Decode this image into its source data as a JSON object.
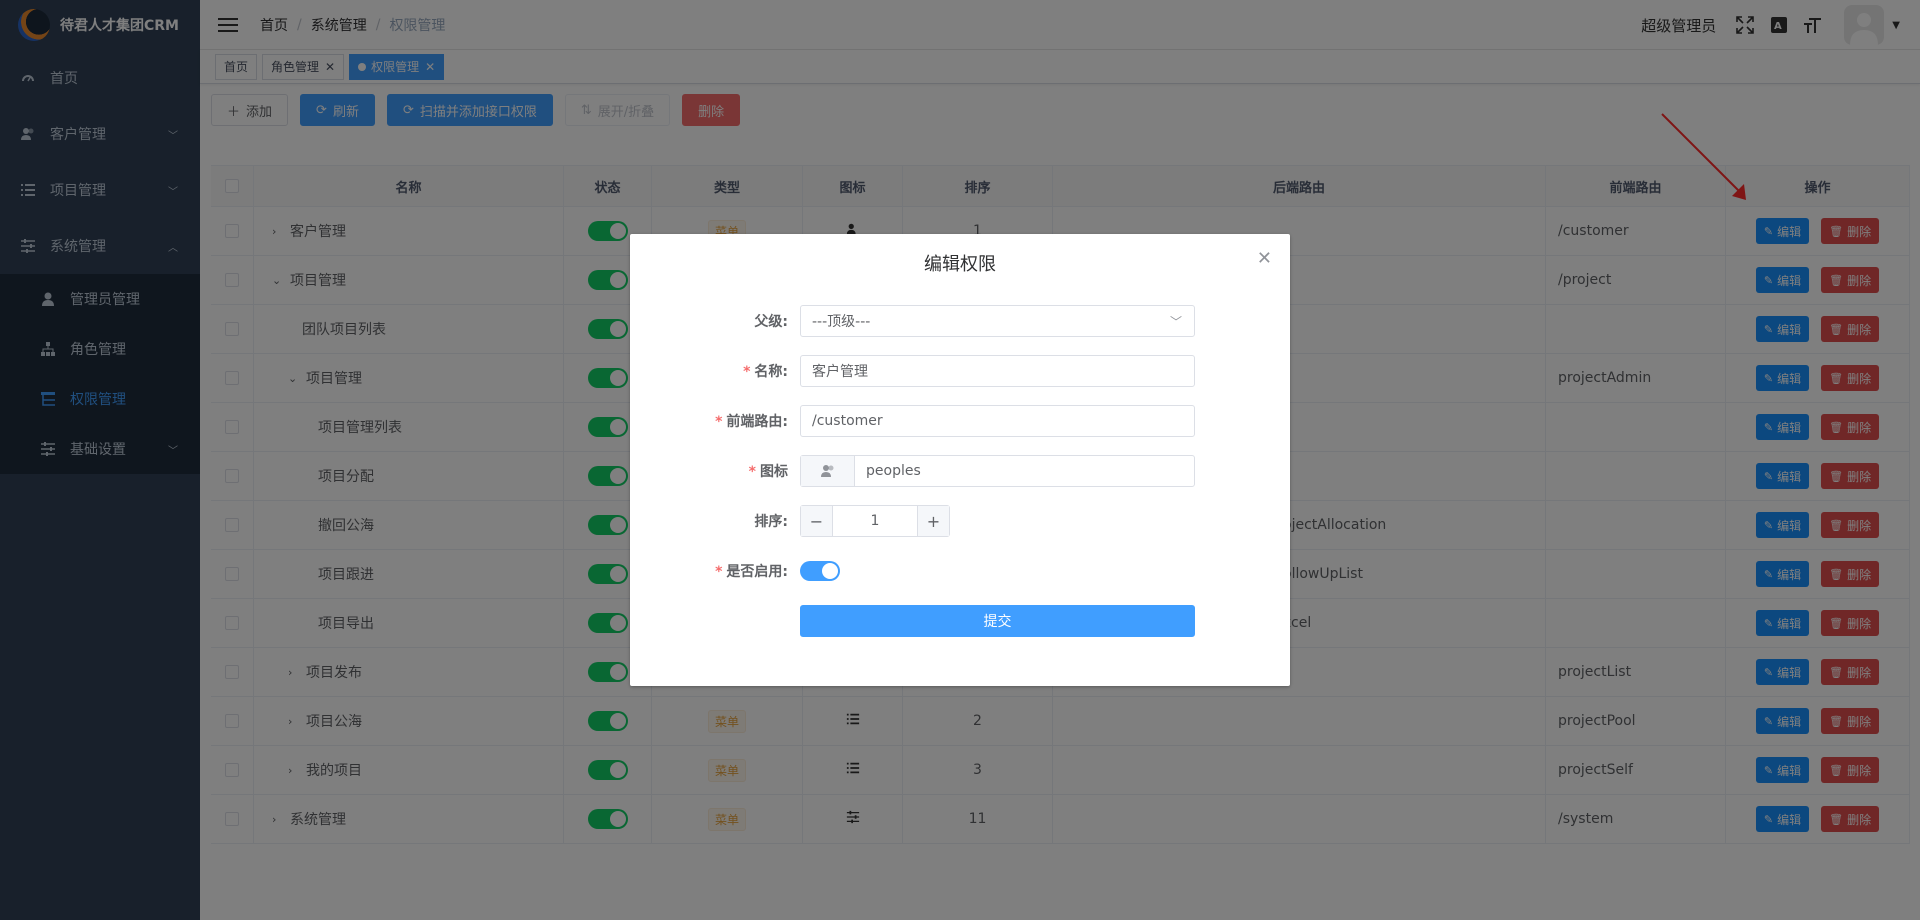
{
  "app": {
    "logo_text": "待君人才集团CRM"
  },
  "sidebar": {
    "items": [
      {
        "label": "首页",
        "icon": "dashboard-icon"
      },
      {
        "label": "客户管理",
        "icon": "peoples-icon"
      },
      {
        "label": "项目管理",
        "icon": "list-icon"
      },
      {
        "label": "系统管理",
        "icon": "system-icon"
      }
    ],
    "sub_items": [
      {
        "label": "管理员管理",
        "icon": "user-icon"
      },
      {
        "label": "角色管理",
        "icon": "tree-icon"
      },
      {
        "label": "权限管理",
        "icon": "tree-table-icon"
      },
      {
        "label": "基础设置",
        "icon": "settings-icon"
      }
    ]
  },
  "header": {
    "breadcrumb": [
      "首页",
      "系统管理",
      "权限管理"
    ],
    "username": "超级管理员",
    "font_icon": "A"
  },
  "tags": [
    {
      "label": "首页"
    },
    {
      "label": "角色管理"
    },
    {
      "label": "权限管理"
    }
  ],
  "toolbar": {
    "add": "添加",
    "refresh": "刷新",
    "scan": "扫描并添加接口权限",
    "expand": "展开/折叠",
    "delete": "删除"
  },
  "table": {
    "headers": {
      "name": "名称",
      "status": "状态",
      "type": "类型",
      "icon": "图标",
      "sort": "排序",
      "backend": "后端路由",
      "frontend": "前端路由",
      "ops": "操作"
    },
    "edit_label": "编辑",
    "delete_label": "删除",
    "rows": [
      {
        "name": "客户管理",
        "type": "菜单",
        "sort": "1",
        "backend": "",
        "frontend": "/customer"
      },
      {
        "name": "项目管理",
        "type": "",
        "sort": "",
        "backend": "",
        "frontend": "/project"
      },
      {
        "name": "团队项目列表",
        "type": "",
        "sort": "",
        "backend": "",
        "frontend": ""
      },
      {
        "name": "项目管理",
        "type": "",
        "sort": "",
        "backend": "",
        "frontend": "projectAdmin"
      },
      {
        "name": "项目管理列表",
        "type": "",
        "sort": "",
        "backend": "",
        "frontend": ""
      },
      {
        "name": "项目分配",
        "type": "",
        "sort": "",
        "backend": "",
        "frontend": ""
      },
      {
        "name": "撤回公海",
        "type": "",
        "sort": "",
        "backend": "ojectAllocation",
        "frontend": ""
      },
      {
        "name": "项目跟进",
        "type": "",
        "sort": "",
        "backend": "ollowUpList",
        "frontend": ""
      },
      {
        "name": "项目导出",
        "type": "",
        "sort": "",
        "backend": "xcel",
        "frontend": ""
      },
      {
        "name": "项目发布",
        "type": "",
        "sort": "",
        "backend": "",
        "frontend": "projectList"
      },
      {
        "name": "项目公海",
        "type": "菜单",
        "sort": "2",
        "backend": "",
        "frontend": "projectPool"
      },
      {
        "name": "我的项目",
        "type": "菜单",
        "sort": "3",
        "backend": "",
        "frontend": "projectSelf"
      },
      {
        "name": "系统管理",
        "type": "菜单",
        "sort": "11",
        "backend": "",
        "frontend": "/system"
      }
    ]
  },
  "dialog": {
    "title": "编辑权限",
    "parent_label": "父级:",
    "parent_value": "---顶级---",
    "name_label": "名称:",
    "name_value": "客户管理",
    "route_label": "前端路由:",
    "route_value": "/customer",
    "icon_label": "图标",
    "icon_value": "peoples",
    "sort_label": "排序:",
    "sort_value": "1",
    "enabled_label": "是否启用:",
    "enabled": true,
    "submit": "提交"
  },
  "colors": {
    "sidebar_bg": "#304156",
    "primary": "#409eff",
    "danger": "#f56c6c",
    "switch_on": "#13ce66"
  }
}
